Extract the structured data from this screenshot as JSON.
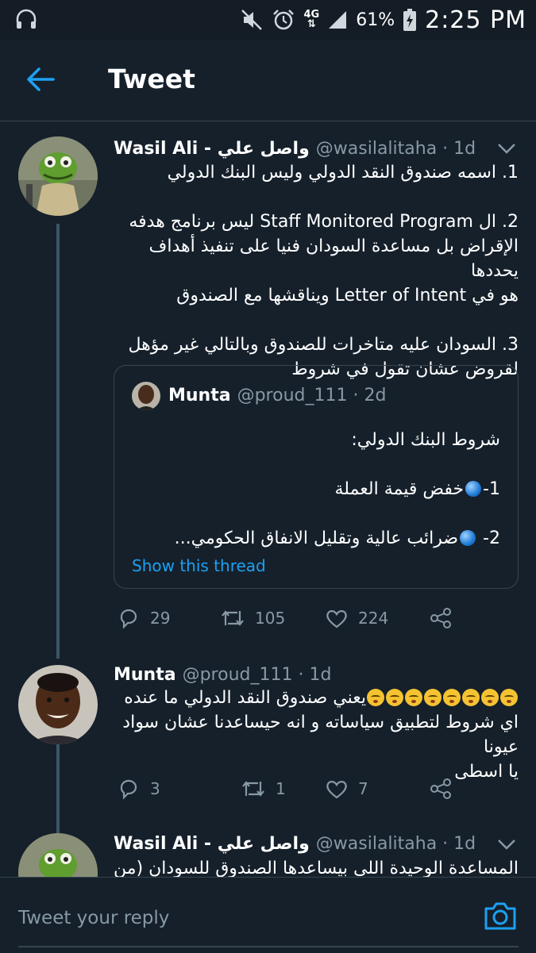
{
  "status_bar": {
    "battery_pct": "61%",
    "time": "2:25 PM",
    "network": "4G"
  },
  "header": {
    "title": "Tweet"
  },
  "tweets": [
    {
      "name": "Wasil Ali - واصل علي",
      "handle": "@wasilalitaha · 1d",
      "lines": [
        "1. اسمه صندوق النقد الدولي وليس البنك الدولي",
        "",
        "2. ال Staff Monitored Program ليس برنامج هدفه",
        "الإقراض بل مساعدة السودان فنيا على تنفيذ أهداف يحددها",
        "هو في Letter of Intent ويناقشها مع الصندوق",
        "",
        "3. السودان عليه متاخرات للصندوق وبالتالي غير مؤهل",
        "لقروض عشان تقول في شروط"
      ],
      "quote": {
        "name": "Munta",
        "handle": "@proud_111 · 2d",
        "line1": "شروط البنك الدولي:",
        "line2": "خفض قيمة العملة",
        "line2_prefix": "1-",
        "line3": "ضرائب عالية وتقليل الانفاق الحكومي...",
        "line3_prefix": "2-",
        "show_thread": "Show this thread"
      },
      "replies": "29",
      "retweets": "105",
      "likes": "224"
    },
    {
      "name": "Munta",
      "handle": "@proud_111 · 1d",
      "line1_text": "يعني صندوق النقد الدولي ما عنده",
      "emoji_count": 8,
      "line2": "اي شروط لتطبيق سياساته و انه حيساعدنا عشان سواد عيونا",
      "line3": "يا اسطى",
      "replies": "3",
      "retweets": "1",
      "likes": "7"
    },
    {
      "name": "Wasil Ali - واصل علي",
      "handle": "@wasilalitaha · 1d",
      "line1": "المساعدة الوحيدة اللى بيساعدها الصندوق للسودان (من ايام"
    }
  ],
  "reply": {
    "placeholder": "Tweet your reply"
  }
}
